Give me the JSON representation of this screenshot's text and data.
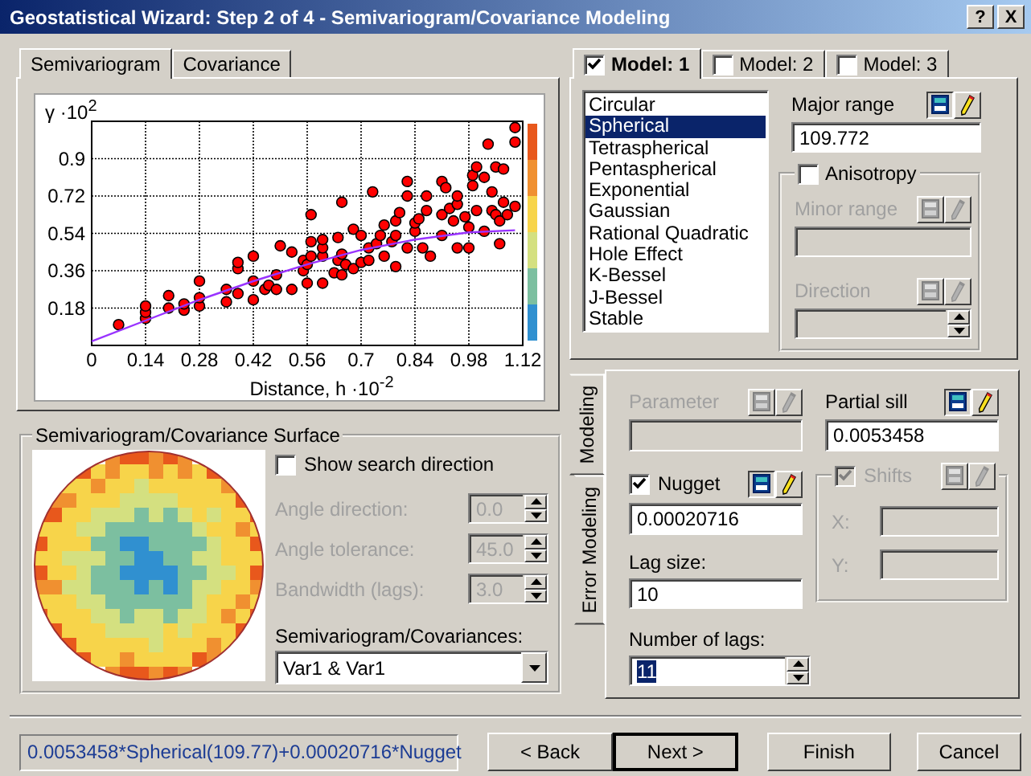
{
  "window": {
    "title": "Geostatistical Wizard: Step 2 of 4 - Semivariogram/Covariance Modeling",
    "controls": [
      "?",
      "X"
    ]
  },
  "chart_tabs": [
    {
      "label": "Semivariogram",
      "selected": true
    },
    {
      "label": "Covariance",
      "selected": false
    }
  ],
  "chart": {
    "chart_data": {
      "type": "scatter",
      "xlabel": "Distance, h ·10$^{-2}$",
      "ylabel": "γ ·10$^{2}$",
      "grid": true,
      "xlim": [
        0,
        1.12
      ],
      "ylim": [
        0,
        1.08
      ],
      "xticks": [
        0,
        0.14,
        0.28,
        0.42,
        0.56,
        0.7,
        0.84,
        0.98,
        1.12
      ],
      "yticks": [
        0.18,
        0.36,
        0.54,
        0.72,
        0.9
      ],
      "series": [
        {
          "color": "#ff0000",
          "x": [
            0.07,
            0.14,
            0.14,
            0.14,
            0.2,
            0.2,
            0.24,
            0.24,
            0.28,
            0.28,
            0.28,
            0.35,
            0.35,
            0.38,
            0.38,
            0.38,
            0.42,
            0.42,
            0.42,
            0.45,
            0.46,
            0.48,
            0.48,
            0.49,
            0.52,
            0.52,
            0.55,
            0.55,
            0.56,
            0.56,
            0.57,
            0.57,
            0.57,
            0.6,
            0.6,
            0.6,
            0.6,
            0.63,
            0.64,
            0.64,
            0.65,
            0.65,
            0.65,
            0.66,
            0.68,
            0.68,
            0.7,
            0.7,
            0.72,
            0.72,
            0.73,
            0.74,
            0.75,
            0.76,
            0.76,
            0.78,
            0.79,
            0.79,
            0.79,
            0.8,
            0.82,
            0.82,
            0.82,
            0.84,
            0.84,
            0.85,
            0.86,
            0.87,
            0.87,
            0.88,
            0.91,
            0.91,
            0.91,
            0.92,
            0.93,
            0.94,
            0.95,
            0.95,
            0.95,
            0.97,
            0.98,
            0.98,
            0.99,
            0.99,
            1.0,
            1.0,
            1.02,
            1.02,
            1.03,
            1.04,
            1.04,
            1.05,
            1.05,
            1.06,
            1.06,
            1.07,
            1.07,
            1.08,
            1.1,
            1.1,
            1.1
          ],
          "values": [
            0.1,
            0.13,
            0.16,
            0.19,
            0.18,
            0.24,
            0.17,
            0.2,
            0.19,
            0.23,
            0.31,
            0.21,
            0.27,
            0.25,
            0.37,
            0.4,
            0.22,
            0.31,
            0.43,
            0.27,
            0.29,
            0.27,
            0.34,
            0.48,
            0.27,
            0.45,
            0.36,
            0.41,
            0.3,
            0.39,
            0.43,
            0.5,
            0.63,
            0.3,
            0.43,
            0.47,
            0.51,
            0.35,
            0.41,
            0.52,
            0.34,
            0.44,
            0.69,
            0.39,
            0.37,
            0.56,
            0.4,
            0.53,
            0.41,
            0.47,
            0.74,
            0.49,
            0.53,
            0.43,
            0.58,
            0.5,
            0.38,
            0.53,
            0.6,
            0.64,
            0.47,
            0.72,
            0.79,
            0.55,
            0.59,
            0.61,
            0.47,
            0.65,
            0.72,
            0.43,
            0.53,
            0.63,
            0.79,
            0.76,
            0.66,
            0.6,
            0.68,
            0.72,
            0.47,
            0.62,
            0.47,
            0.57,
            0.77,
            0.82,
            0.65,
            0.86,
            0.55,
            0.81,
            0.97,
            0.65,
            0.74,
            0.63,
            0.86,
            0.49,
            0.6,
            0.69,
            0.85,
            0.63,
            0.67,
            0.98,
            1.05
          ]
        },
        {
          "type": "line",
          "color": "#9933ff",
          "x": [
            0,
            0.14,
            0.28,
            0.42,
            0.56,
            0.7,
            0.84,
            0.98,
            1.1
          ],
          "values": [
            0.02,
            0.12,
            0.22,
            0.31,
            0.39,
            0.46,
            0.51,
            0.545,
            0.555
          ]
        }
      ]
    }
  },
  "surface": {
    "title": "Semivariogram/Covariance Surface",
    "show_search_direction": {
      "label": "Show search direction",
      "checked": false
    },
    "angles": [
      {
        "label": "Angle direction:",
        "value": "0.0",
        "disabled": true
      },
      {
        "label": "Angle tolerance:",
        "value": "45.0",
        "disabled": true
      },
      {
        "label": "Bandwidth (lags):",
        "value": "3.0",
        "disabled": true
      }
    ],
    "dropdown": {
      "label": "Semivariogram/Covariances:",
      "value": "Var1 & Var1"
    }
  },
  "model_tabs": [
    {
      "label": "Model: 1",
      "checked": true,
      "selected": true
    },
    {
      "label": "Model: 2",
      "checked": false,
      "selected": false
    },
    {
      "label": "Model: 3",
      "checked": false,
      "selected": false
    }
  ],
  "model_types": [
    {
      "label": "Circular",
      "selected": false
    },
    {
      "label": "Spherical",
      "selected": true
    },
    {
      "label": "Tetraspherical",
      "selected": false
    },
    {
      "label": "Pentaspherical",
      "selected": false
    },
    {
      "label": "Exponential",
      "selected": false
    },
    {
      "label": "Gaussian",
      "selected": false
    },
    {
      "label": "Rational Quadratic",
      "selected": false
    },
    {
      "label": "Hole Effect",
      "selected": false
    },
    {
      "label": "K-Bessel",
      "selected": false
    },
    {
      "label": "J-Bessel",
      "selected": false
    },
    {
      "label": "Stable",
      "selected": false
    }
  ],
  "major_range": {
    "label": "Major range",
    "value": "109.772",
    "disabled": false
  },
  "anisotropy": {
    "label": "Anisotropy",
    "checked": false
  },
  "minor_range": {
    "label": "Minor range",
    "disabled": true
  },
  "direction": {
    "label": "Direction",
    "disabled": true
  },
  "side_tabs": [
    {
      "label": "Modeling",
      "selected": true
    },
    {
      "label": "Error Modeling",
      "selected": false
    }
  ],
  "parameter": {
    "label": "Parameter",
    "disabled": true
  },
  "partial_sill": {
    "label": "Partial sill",
    "value": "0.0053458",
    "disabled": false
  },
  "nugget": {
    "label": "Nugget",
    "checked": true,
    "value": "0.00020716",
    "disabled": false
  },
  "shifts": {
    "label": "Shifts",
    "checked": true,
    "disabled": true,
    "x_label": "X:",
    "y_label": "Y:"
  },
  "lag_size": {
    "label": "Lag size:",
    "value": "10"
  },
  "number_of_lags": {
    "label": "Number of lags:",
    "value": "11",
    "text_selected": true
  },
  "footer": {
    "formula": "0.0053458*Spherical(109.77)+0.00020716*Nugget",
    "buttons": [
      {
        "label": "< Back",
        "default": false
      },
      {
        "label": "Next >",
        "default": true
      },
      {
        "label": "Finish",
        "default": false
      },
      {
        "label": "Cancel",
        "default": false
      }
    ]
  }
}
